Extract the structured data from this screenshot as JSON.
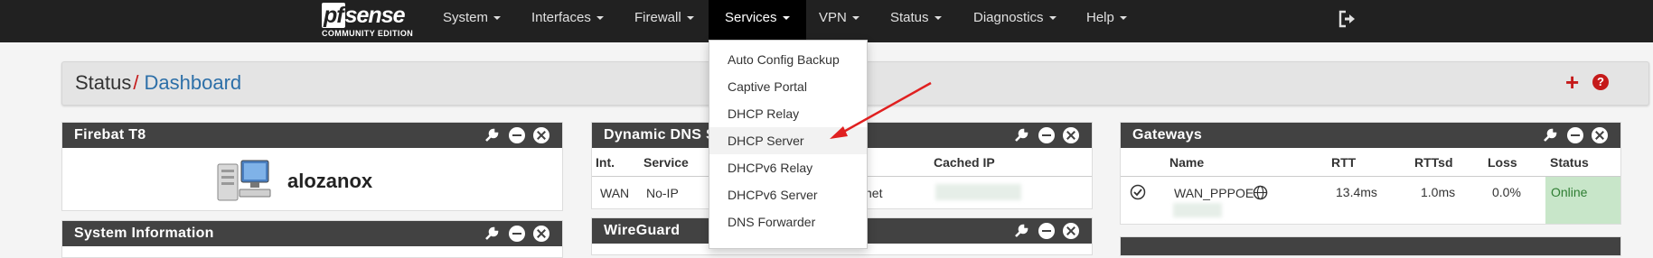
{
  "brand": {
    "logo": "sense",
    "logo_pf": "pf",
    "subtitle": "COMMUNITY EDITION"
  },
  "nav": {
    "items": [
      "System",
      "Interfaces",
      "Firewall",
      "Services",
      "VPN",
      "Status",
      "Diagnostics",
      "Help"
    ],
    "active": "Services",
    "logout_icon": "sign-out-icon"
  },
  "breadcrumb": {
    "section": "Status",
    "separator": "/",
    "page": "Dashboard",
    "add_icon": "plus-icon",
    "help_icon": "question-circle-icon",
    "help_glyph": "?"
  },
  "panels": {
    "firebat": {
      "title": "Firebat T8",
      "hostname": "alozanox"
    },
    "sysinfo": {
      "title": "System Information"
    },
    "dyndns": {
      "title": "Dynamic DNS S",
      "headers": [
        "Int.",
        "Service",
        "Cached IP"
      ],
      "row": {
        "int": "WAN",
        "service": "No-IP",
        "hostname_tail": "net"
      }
    },
    "wireguard": {
      "title": "WireGuard"
    },
    "gateways": {
      "title": "Gateways",
      "headers": [
        "Name",
        "RTT",
        "RTTsd",
        "Loss",
        "Status"
      ],
      "row": {
        "name": "WAN_PPPOE",
        "rtt": "13.4ms",
        "rttsd": "1.0ms",
        "loss": "0.0%",
        "status": "Online"
      }
    }
  },
  "services_menu": [
    "Auto Config Backup",
    "Captive Portal",
    "DHCP Relay",
    "DHCP Server",
    "DHCPv6 Relay",
    "DHCPv6 Server",
    "DNS Forwarder"
  ],
  "services_menu_highlighted": "DHCP Server",
  "colors": {
    "navbar": "#212121",
    "accent_red": "#c51a1a",
    "link_blue": "#2c6fa8",
    "panel_head": "#424242",
    "online_green": "#c8e6c9"
  }
}
